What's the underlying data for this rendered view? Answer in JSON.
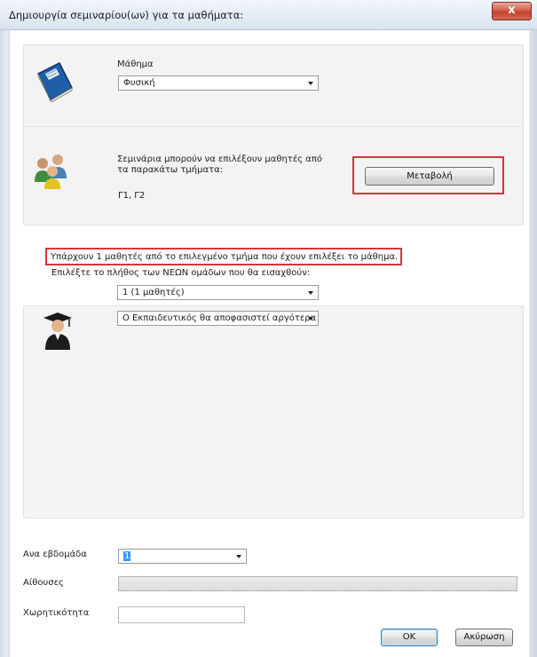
{
  "window": {
    "title": "Δημιουργία σεμιναρίου(ων) για τα μαθήματα:",
    "close": "x"
  },
  "course": {
    "label": "Μάθημα",
    "value": "Φυσική"
  },
  "groups": {
    "description": "Σεμινάρια μπορούν να επιλέξουν μαθητές από τα παρακάτω τμήματα:",
    "classes": "Γ1, Γ2",
    "change_button": "Μεταβολή"
  },
  "info_message": "Υπάρχουν 1 μαθητές από το επιλεγμένο τμήμα που έχουν επιλέξει το μάθημα.",
  "new_groups": {
    "label": "Επιλέξτε το πλήθος των ΝΕΩΝ ομάδων που θα εισαχθούν:",
    "value": "1 (1 μαθητές)"
  },
  "teacher": {
    "value": "Ο Εκπαιδευτικός θα αποφασιστεί αργότερα"
  },
  "weekly": {
    "label": "Ανα εβδομάδα",
    "value": "1"
  },
  "rooms": {
    "label": "Αίθουσες"
  },
  "capacity": {
    "label": "Χωρητικότητα",
    "value": ""
  },
  "buttons": {
    "ok": "OK",
    "cancel": "Ακύρωση"
  },
  "colors": {
    "highlight_border": "#d9343a",
    "selection": "#3399ff"
  },
  "icons": [
    "book-icon",
    "users-icon",
    "graduate-icon"
  ]
}
